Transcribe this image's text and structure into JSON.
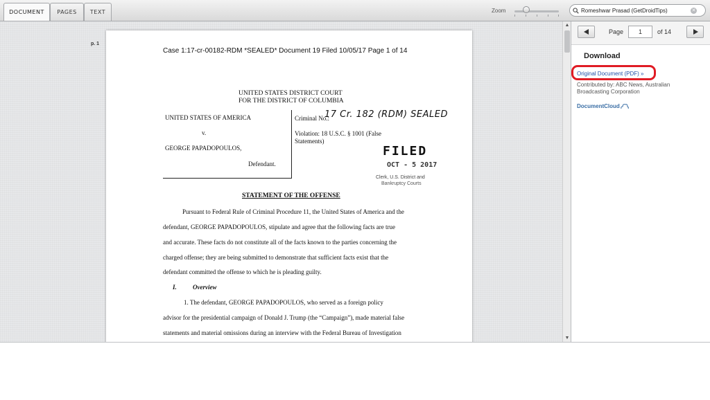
{
  "toolbar": {
    "tabs": [
      {
        "label": "DOCUMENT",
        "active": true
      },
      {
        "label": "PAGES",
        "active": false
      },
      {
        "label": "TEXT",
        "active": false
      }
    ],
    "zoom_label": "Zoom",
    "zoom_level": 0.27,
    "search_value": "Romeshwar Prasad (GetDroidTips)",
    "search_icon": "magnifier-icon",
    "clear_icon": "close-icon"
  },
  "viewer": {
    "page_marker": "p. 1",
    "document": {
      "header": "Case 1:17-cr-00182-RDM *SEALED*   Document 19   Filed 10/05/17   Page 1 of 14",
      "court_line1": "UNITED STATES DISTRICT COURT",
      "court_line2": "FOR THE DISTRICT OF COLUMBIA",
      "party1": "UNITED STATES OF AMERICA",
      "versus": "v.",
      "party2": "GEORGE PAPADOPOULOS,",
      "defendant_label": "Defendant.",
      "criminal_no": "Criminal No.:",
      "criminal_no_handwritten": "17 Cr. 182 (RDM) SEALED",
      "violation_line1": "Violation: 18 U.S.C. § 1001 (False",
      "violation_line2": "Statements)",
      "stamp_filed": "FILED",
      "stamp_date": "OCT - 5 2017",
      "stamp_clerk1": "Clerk, U.S. District and",
      "stamp_clerk2": "Bankruptcy Courts",
      "statement_title": "STATEMENT OF THE OFFENSE",
      "body_lines": [
        "Pursuant to Federal Rule of Criminal Procedure 11, the United States of America and the",
        "defendant, GEORGE PAPADOPOULOS, stipulate and agree that the following facts are true",
        "and accurate.  These facts do not constitute all of the facts known to the parties concerning the",
        "charged offense; they are being submitted to demonstrate that sufficient facts exist that the",
        "defendant committed the offense to which he is pleading guilty."
      ],
      "section_number": "I.",
      "section_title": "Overview",
      "overview_lines": [
        "1.        The defendant, GEORGE PAPADOPOULOS, who served as a foreign policy",
        "advisor for the presidential campaign of Donald J. Trump (the “Campaign”), made material false",
        "statements and material omissions during an interview with the Federal Bureau of Investigation"
      ]
    }
  },
  "sidebar": {
    "page_label": "Page",
    "current_page": "1",
    "total_pages_label": "of  14",
    "prev_icon": "triangle-left-icon",
    "next_icon": "triangle-right-icon",
    "download_heading": "Download",
    "original_link": "Original Document (PDF) »",
    "highlight_color": "#e01b24",
    "contributed_by": "Contributed by: ABC News, Australian Broadcasting Corporation",
    "logo_text": "DocumentCloud"
  }
}
